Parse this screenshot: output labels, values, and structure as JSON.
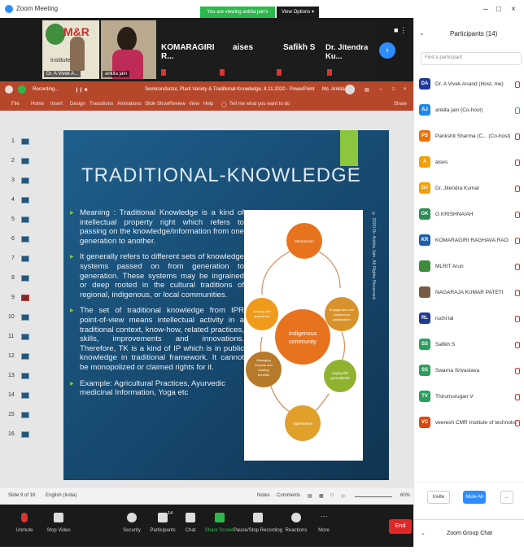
{
  "window": {
    "title": "Zoom Meeting",
    "viewing_banner": "You are viewing ankita jain's screen",
    "view_options": "View Options ▾",
    "min_icon": "minimize-icon",
    "max_icon": "maximize-icon",
    "close_icon": "close-icon"
  },
  "video_strip": {
    "logo_text": "M&R",
    "logo_sub": "Institute of",
    "self_label": "Dr. A Vivek A...",
    "tile2_label": "ankita jain",
    "tiles": [
      "KOMARAGIRI R...",
      "aises",
      "Safikh S",
      "Dr. Jitendra Ku..."
    ]
  },
  "ppt": {
    "title": "Semiconductor, Plant Variety & Traditional Knowledge, 8.11.2020 - PowerPoint",
    "recording": "Recording...",
    "user": "Ms. Ankita Jain",
    "menu": [
      "File",
      "Home",
      "Insert",
      "Design",
      "Transitions",
      "Animations",
      "Slide Show",
      "Review",
      "View",
      "Help",
      "Tell me what you want to do"
    ],
    "share": "Share",
    "slide_numbers": [
      "1",
      "2",
      "3",
      "4",
      "5",
      "6",
      "7",
      "8",
      "9",
      "10",
      "11",
      "12",
      "13",
      "14",
      "15",
      "16"
    ],
    "slide": {
      "title": "TRADITIONAL-KNOWLEDGE",
      "bullets": [
        "Meaning : Traditional Knowledge is a kind of intellectual property right which refers to passing on the knowledge/information from one generation to another.",
        "It generally refers to different sets of knowledge systems passed on from generation to generation. These systems may be ingrained or deep rooted in the cultural traditions of regional, indigenous, or local communities.",
        "The set of traditional knowledge from IPR point-of-view means intellectual activity in a traditional context, know-how, related practices, skills, improvements and innovations. Therefore, TK is a kind of IP which is in public knowledge in traditional framework. It cannot be monopolized or claimed rights for it.",
        "Example: Agricultural Practices, Ayurvedic medicinal Information, Yoga etc"
      ],
      "watermark": "© 2020 Dr. Ankita Jain. All Rights Reserved.",
      "diagram": {
        "center": "Indigenous community",
        "nodes": [
          "Introduction",
          "Engagement and indigenous participation",
          "Laying the groundwork",
          "Agreements",
          "Managing impacts and sharing benefits",
          "Dealing with grievances"
        ]
      }
    },
    "status": {
      "slide_of": "Slide 9 of 16",
      "language": "English (India)",
      "notes": "Notes",
      "comments": "Comments",
      "zoom": "60%"
    }
  },
  "toolbar": {
    "unmute": "Unmute",
    "stop_video": "Stop Video",
    "security": "Security",
    "participants": "Participants",
    "participants_count": "14",
    "chat": "Chat",
    "share_screen": "Share Screen",
    "record": "Pause/Stop Recording",
    "reactions": "Reactions",
    "more": "More",
    "end": "End"
  },
  "participants_panel": {
    "title": "Participants (14)",
    "search_placeholder": "Find a participant",
    "items": [
      {
        "initials": "DA",
        "name": "Dr. A Vivek Anand (Host, me)",
        "color": "#1f3a93"
      },
      {
        "initials": "AJ",
        "name": "ankita jain (Co-host)",
        "color": "#1e88e5"
      },
      {
        "initials": "PS",
        "name": "Parikshit Sharma (C... (Co-host)",
        "color": "#e8710a"
      },
      {
        "initials": "A",
        "name": "aises",
        "color": "#f2a007"
      },
      {
        "initials": "DJ",
        "name": "Dr. Jitendra Kumar",
        "color": "#f2a007"
      },
      {
        "initials": "GK",
        "name": "G KRISHNAIAH",
        "color": "#2e8b57"
      },
      {
        "initials": "KR",
        "name": "KOMARAGIRI RAGHAVA RAO",
        "color": "#1f5fa8"
      },
      {
        "initials": "",
        "name": "MLRIT Arun",
        "color": "#3d8b3d"
      },
      {
        "initials": "",
        "name": "NAGARAJA KUMAR PATETI",
        "color": "#7a5c45"
      },
      {
        "initials": "RL",
        "name": "ruchi lal",
        "color": "#1f3a93"
      },
      {
        "initials": "SS",
        "name": "Safikh S",
        "color": "#2e9e5e"
      },
      {
        "initials": "SS",
        "name": "Swarna Srivastava",
        "color": "#2e9e5e"
      },
      {
        "initials": "TV",
        "name": "Thirumurugan V",
        "color": "#2e9e5e"
      },
      {
        "initials": "VC",
        "name": "veeresh CMR Institute of technology",
        "color": "#d9480f"
      }
    ],
    "invite": "Invite",
    "mute_all": "Mute All",
    "more": "...",
    "chat_title": "Zoom Group Chat"
  }
}
